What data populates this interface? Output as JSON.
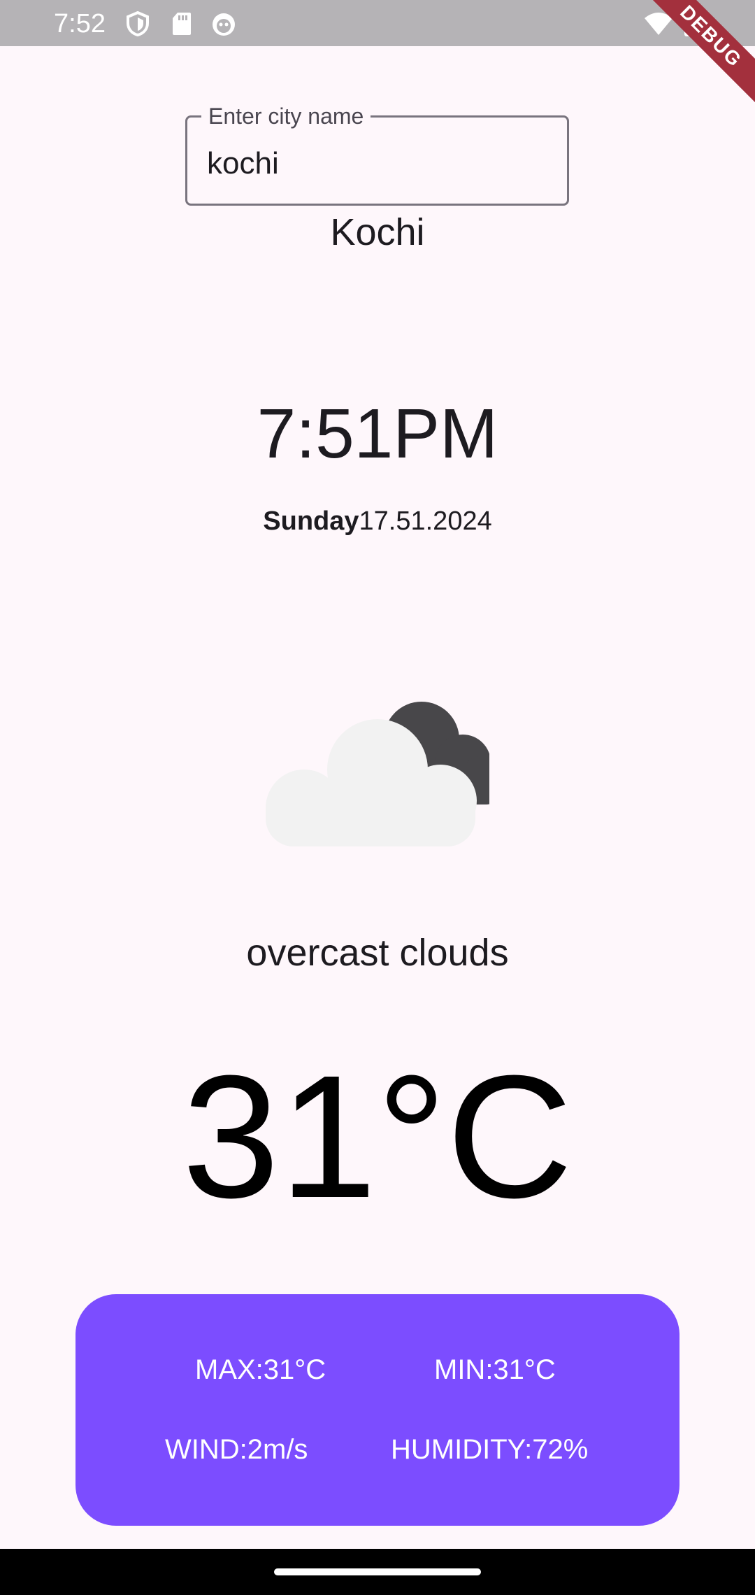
{
  "status_bar": {
    "time": "7:52",
    "icons": [
      "shield-icon",
      "sd-card-icon",
      "android-debug-icon",
      "wifi-icon",
      "battery-icon"
    ],
    "background": "#b5b3b6"
  },
  "debug_banner": "DEBUG",
  "city_input": {
    "label": "Enter city name",
    "value": "kochi"
  },
  "city_name": "Kochi",
  "time": "7:51PM",
  "date": {
    "day": "Sunday",
    "date": "17.51.2024"
  },
  "weather": {
    "icon": "overcast-clouds-icon",
    "condition": "overcast clouds",
    "temperature": "31°C"
  },
  "stats": {
    "max": "MAX:31°C",
    "min": "MIN:31°C",
    "wind": "WIND:2m/s",
    "humidity": "HUMIDITY:72%"
  },
  "colors": {
    "accent": "#7c4dff",
    "background": "#fef7fb"
  }
}
